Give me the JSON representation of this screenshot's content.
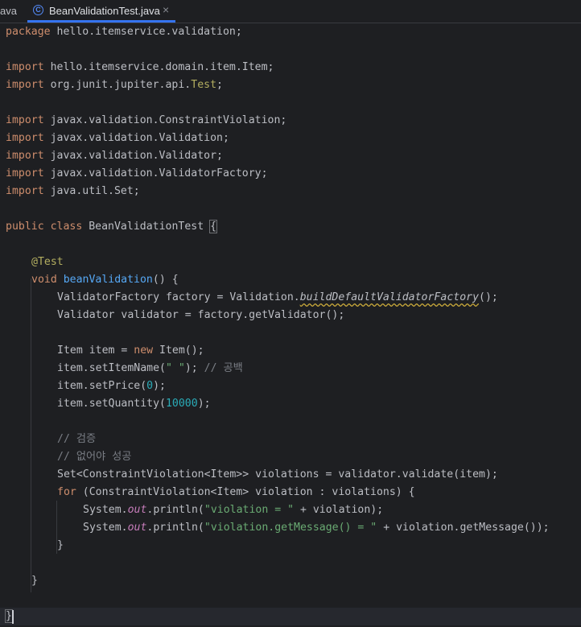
{
  "tabs": {
    "partial_label": "ava",
    "active_label": "BeanValidationTest.java",
    "active_icon": "C",
    "close_glyph": "×"
  },
  "code": {
    "pkg_kw": "package",
    "pkg_name": " hello.itemservice.validation;",
    "imp": "import",
    "imp1": " hello.itemservice.domain.item.Item;",
    "imp2a": " org.junit.jupiter.api.",
    "imp2b": "Test",
    "imp2c": ";",
    "imp3": " javax.validation.ConstraintViolation;",
    "imp4": " javax.validation.Validation;",
    "imp5": " javax.validation.Validator;",
    "imp6": " javax.validation.ValidatorFactory;",
    "imp7": " java.util.Set;",
    "cls_public": "public",
    "cls_class": "class",
    "cls_name": " BeanValidationTest ",
    "cls_brace": "{",
    "ann_test": "@Test",
    "m_void": "void",
    "m_name": "beanValidation",
    "m_rest": "() {",
    "l_factory_a": "ValidatorFactory factory = Validation.",
    "l_factory_b": "buildDefaultValidatorFactory",
    "l_factory_c": "();",
    "l_validator": "Validator validator = factory.getValidator();",
    "l_item_a": "Item item = ",
    "l_item_new": "new",
    "l_item_b": " Item();",
    "l_name_a": "item.setItemName(",
    "l_name_str": "\" \"",
    "l_name_b": "); ",
    "l_name_cmt": "// 공백",
    "l_price_a": "item.setPrice(",
    "l_price_num": "0",
    "l_price_b": ");",
    "l_qty_a": "item.setQuantity(",
    "l_qty_num": "10000",
    "l_qty_b": ");",
    "cmt1": "// 검증",
    "cmt2": "// 없어야 성공",
    "l_set": "Set<ConstraintViolation<Item>> violations = validator.validate(item);",
    "l_for_kw": "for",
    "l_for_rest": " (ConstraintViolation<Item> violation : violations) {",
    "p1_a": "System.",
    "p1_out": "out",
    "p1_b": ".println(",
    "p1_str": "\"violation = \"",
    "p1_c": " + violation);",
    "p2_a": "System.",
    "p2_out": "out",
    "p2_b": ".println(",
    "p2_str": "\"violation.getMessage() = \"",
    "p2_c": " + violation.getMessage());",
    "close_for": "}",
    "close_method": "}",
    "close_class": "}"
  }
}
